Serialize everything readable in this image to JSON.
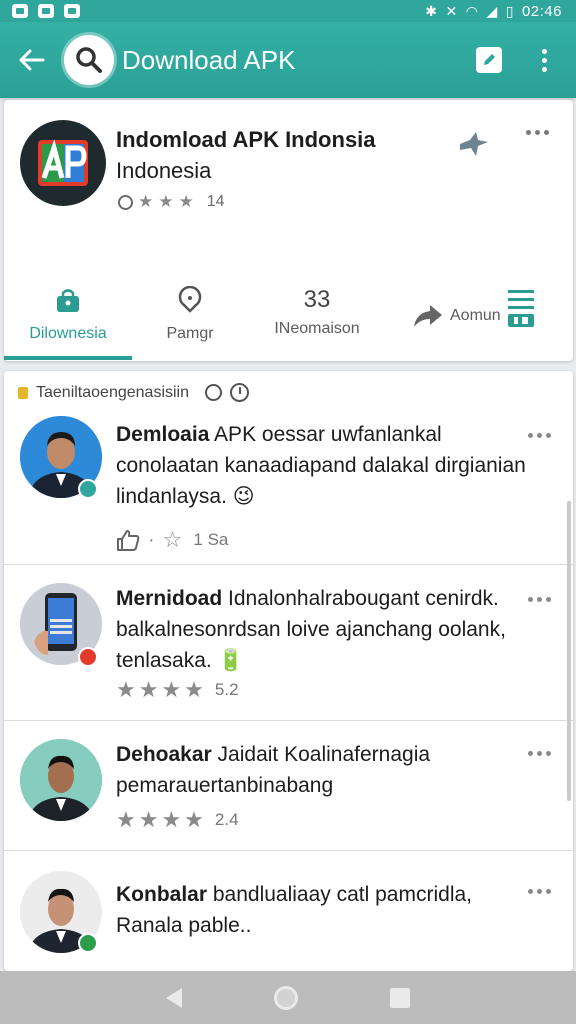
{
  "status_bar": {
    "time": "02:46"
  },
  "app_bar": {
    "title": "Download APK"
  },
  "app": {
    "name_line1": "Indomload APK Indonsia",
    "name_line2": "Indonesia",
    "rating_count": "14"
  },
  "tabs": [
    {
      "label": "Dilownesia",
      "active": true
    },
    {
      "label": "Pamgr"
    },
    {
      "label": "INeomaison",
      "number": "33"
    },
    {
      "label": "Aomun"
    }
  ],
  "reviews_header": {
    "title": "Taeniltaoengenasisiin"
  },
  "reviews": [
    {
      "title": "Demloaia",
      "text_rest": " APK oessar uwfanlankal conolaatan kanaadiapand dalakal dirgianian lindanlaysa.",
      "emoji": "😉",
      "meta": "1 Sa",
      "stars": "☆"
    },
    {
      "title": "Mernidoad",
      "text_rest": " Idnalonhalrabougant cenirdk. balkalnesonrdsan loive ajanchang oolank, tenlasaka.",
      "emoji": "🔋",
      "meta": "5.2",
      "stars": "★★★★"
    },
    {
      "title": "Dehoakar",
      "text_rest": " Jaidait Koalinafernagia pemarauertanbinabang",
      "emoji": "",
      "meta": "2.4",
      "stars": "★★★★"
    },
    {
      "title": "Konbalar",
      "text_rest": " bandlualiaay catl pamcridla, Ranala pable..",
      "emoji": "",
      "meta": "",
      "stars": ""
    }
  ],
  "colors": {
    "teal": "#2fa79d",
    "text": "#1d1d1d"
  }
}
